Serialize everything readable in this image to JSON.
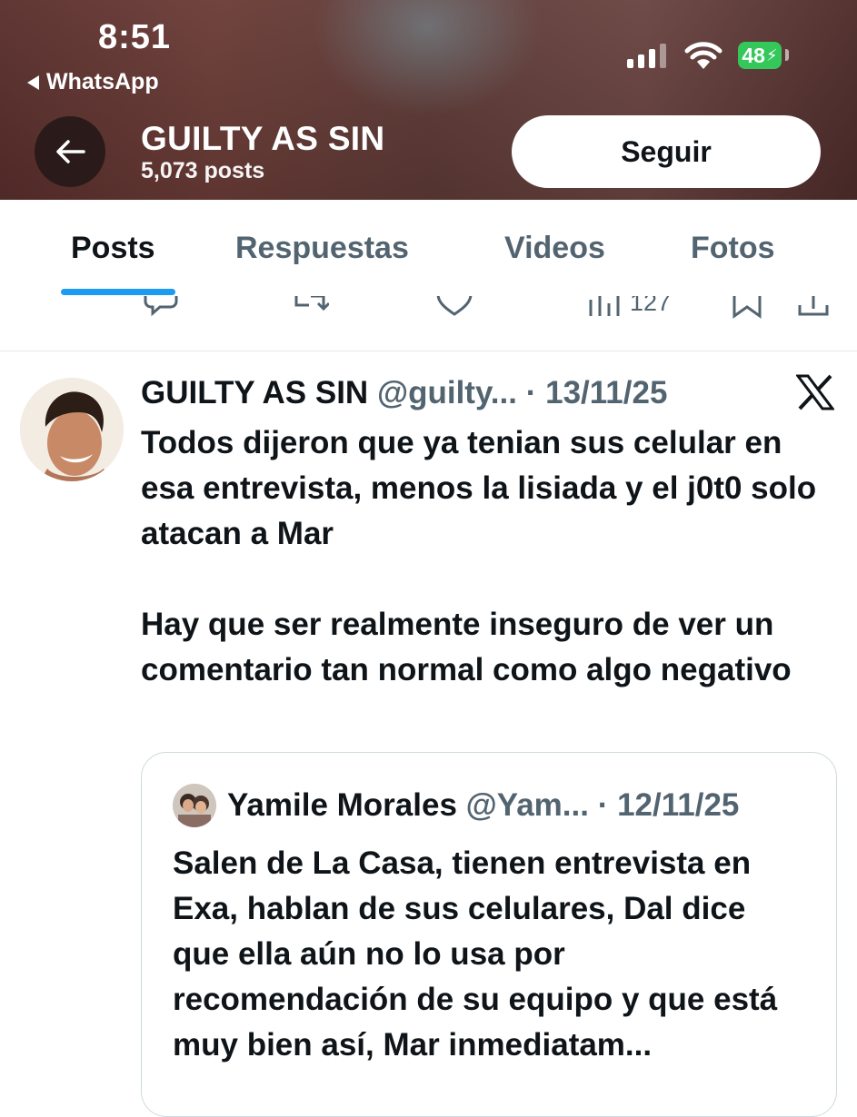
{
  "status_bar": {
    "time": "8:51",
    "back_app": "WhatsApp",
    "battery": "48"
  },
  "profile": {
    "name": "GUILTY AS SIN",
    "posts_count": "5,073 posts",
    "follow_label": "Seguir"
  },
  "tabs": [
    {
      "label": "Posts",
      "active": true
    },
    {
      "label": "Respuestas",
      "active": false
    },
    {
      "label": "Videos",
      "active": false
    },
    {
      "label": "Fotos",
      "active": false
    }
  ],
  "previous_tweet_actions": {
    "views": "127",
    "icons": [
      "reply-icon",
      "retweet-icon",
      "like-icon",
      "views-icon",
      "bookmark-icon",
      "share-icon"
    ]
  },
  "tweet": {
    "author": "GUILTY AS SIN",
    "handle": "@guilty...",
    "date": "· 13/11/25",
    "paragraphs": [
      "Todos dijeron que ya tenian sus celular en esa entrevista, menos la lisiada y el j0t0 solo atacan a Mar",
      "Hay que ser realmente inseguro de ver un comentario tan normal como algo negativo"
    ],
    "source_icon": "x-logo-icon"
  },
  "quoted_tweet": {
    "author": "Yamile Morales",
    "handle": "@Yam...",
    "date": "· 12/11/25",
    "text": "Salen de La Casa, tienen entrevista en Exa, hablan de sus celulares, Dal dice que ella aún no lo usa por recomendación de su equipo y que está muy bien así, Mar inmediatam..."
  },
  "colors": {
    "accent": "#1d9bf0",
    "battery": "#34c759",
    "banner": "#5e3a36",
    "secondary_text": "#536471"
  }
}
